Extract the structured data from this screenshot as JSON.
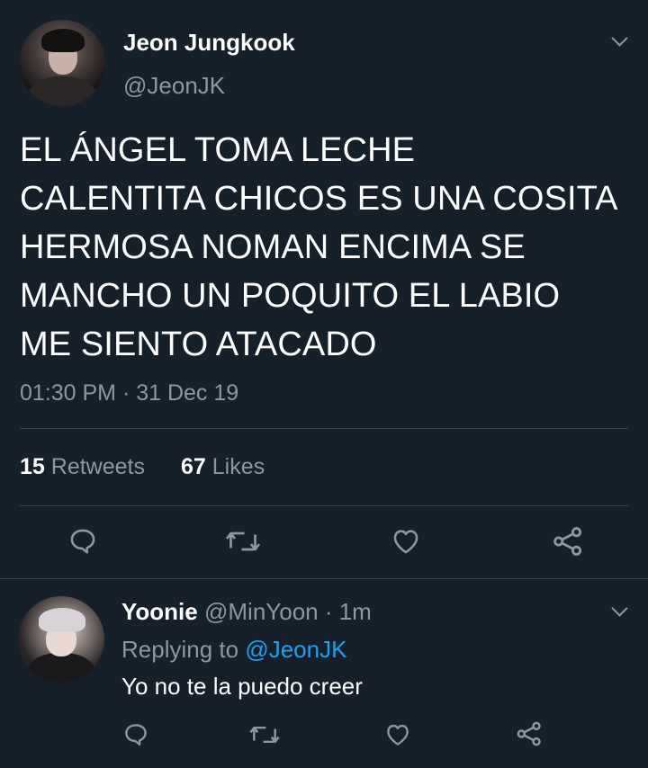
{
  "main_tweet": {
    "author_name": "Jeon Jungkook",
    "author_handle": "@JeonJK",
    "text_lines": [
      "EL ÁNGEL TOMA LECHE",
      "CALENTITA CHICOS ES UNA COSITA",
      "HERMOSA NOMAN ENCIMA SE",
      "MANCHO UN POQUITO EL LABIO",
      "ME SIENTO ATACADO"
    ],
    "timestamp": "01:30 PM · 31 Dec 19",
    "retweets_count": "15",
    "retweets_label": "Retweets",
    "likes_count": "67",
    "likes_label": "Likes"
  },
  "reply": {
    "author_name": "Yoonie",
    "author_handle": "@MinYoon",
    "time": "· 1m",
    "replying_label": "Replying to",
    "replying_to": "@JeonJK",
    "text": "Yo no te la puedo creer"
  },
  "icons": [
    "reply-icon",
    "retweet-icon",
    "like-icon",
    "share-icon",
    "chevron-down-icon"
  ],
  "colors": {
    "background": "#15202b",
    "text": "#ffffff",
    "muted": "#8899a6",
    "link": "#1da1f2",
    "divider": "#38444d"
  }
}
